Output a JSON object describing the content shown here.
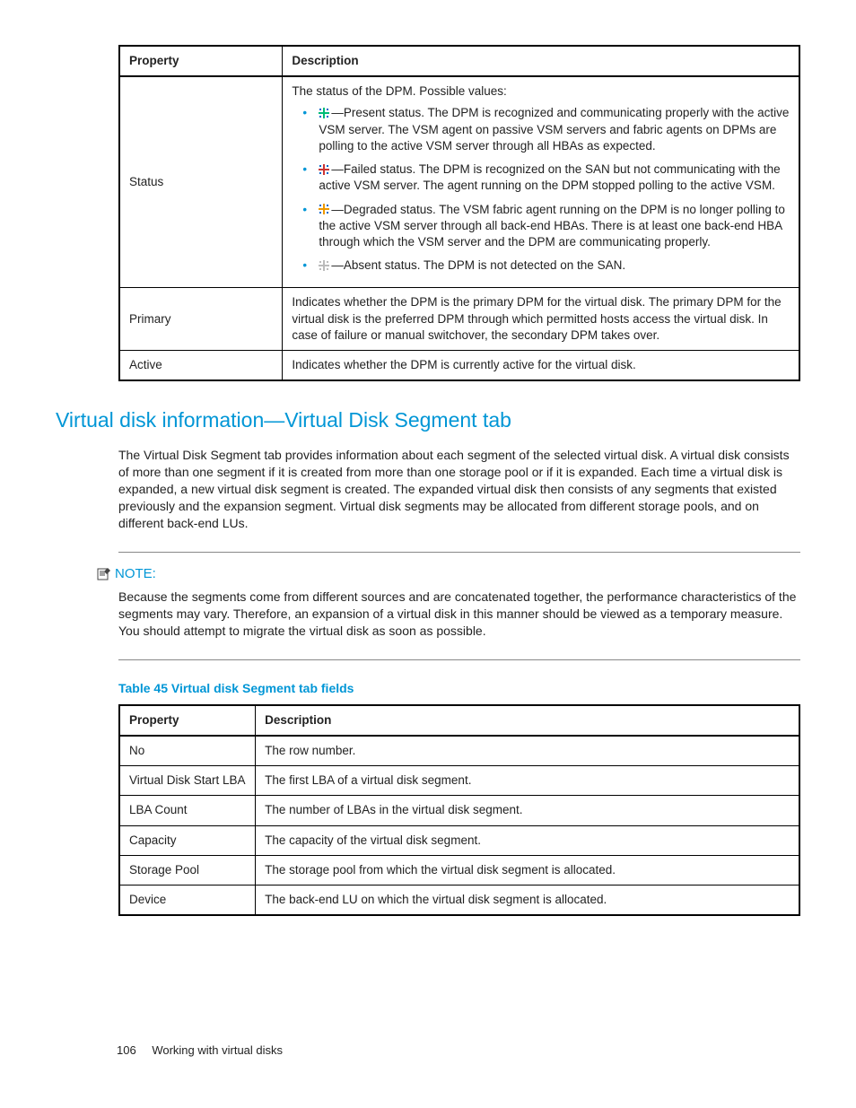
{
  "table1": {
    "headers": {
      "property": "Property",
      "description": "Description"
    },
    "status": {
      "name": "Status",
      "intro": "The status of the DPM. Possible values:",
      "items": [
        "—Present status. The DPM is recognized and communicating properly with the active VSM server. The VSM agent on passive VSM servers and fabric agents on DPMs are polling to the active VSM server through all HBAs as expected.",
        "—Failed status. The DPM is recognized on the SAN but not communicating with the active VSM server. The agent running on the DPM stopped polling to the active VSM.",
        "—Degraded status. The VSM fabric agent running on the DPM is no longer polling to the active VSM server through all back-end HBAs. There is at least one back-end HBA through which the VSM server and the DPM are communicating properly.",
        "—Absent status. The DPM is not detected on the SAN."
      ]
    },
    "primary": {
      "name": "Primary",
      "desc": "Indicates whether the DPM is the primary DPM for the virtual disk. The primary DPM for the virtual disk is the preferred DPM through which permitted hosts access the virtual disk. In case of failure or manual switchover, the secondary DPM takes over."
    },
    "active": {
      "name": "Active",
      "desc": "Indicates whether the DPM is currently active for the virtual disk."
    }
  },
  "section_heading": "Virtual disk information—Virtual Disk Segment tab",
  "intro_paragraph": "The Virtual Disk Segment tab provides information about each segment of the selected virtual disk. A virtual disk consists of more than one segment if it is created from more than one storage pool or if it is expanded. Each time a virtual disk is expanded, a new virtual disk segment is created. The expanded virtual disk then consists of any segments that existed previously and the expansion segment. Virtual disk segments may be allocated from different storage pools, and on different back-end LUs.",
  "note": {
    "label": "NOTE:",
    "body": "Because the segments come from different sources and are concatenated together, the performance characteristics of the segments may vary. Therefore, an expansion of a virtual disk in this manner should be viewed as a temporary measure. You should attempt to migrate the virtual disk as soon as possible."
  },
  "table2": {
    "caption": "Table 45 Virtual disk Segment tab fields",
    "headers": {
      "property": "Property",
      "description": "Description"
    },
    "rows": [
      {
        "p": "No",
        "d": "The row number."
      },
      {
        "p": "Virtual Disk Start LBA",
        "d": "The first LBA of a virtual disk segment."
      },
      {
        "p": "LBA Count",
        "d": "The number of LBAs in the virtual disk segment."
      },
      {
        "p": "Capacity",
        "d": "The capacity of the virtual disk segment."
      },
      {
        "p": "Storage Pool",
        "d": "The storage pool from which the virtual disk segment is allocated."
      },
      {
        "p": "Device",
        "d": "The back-end LU on which the virtual disk segment is allocated."
      }
    ]
  },
  "footer": {
    "page": "106",
    "section": "Working with virtual disks"
  }
}
